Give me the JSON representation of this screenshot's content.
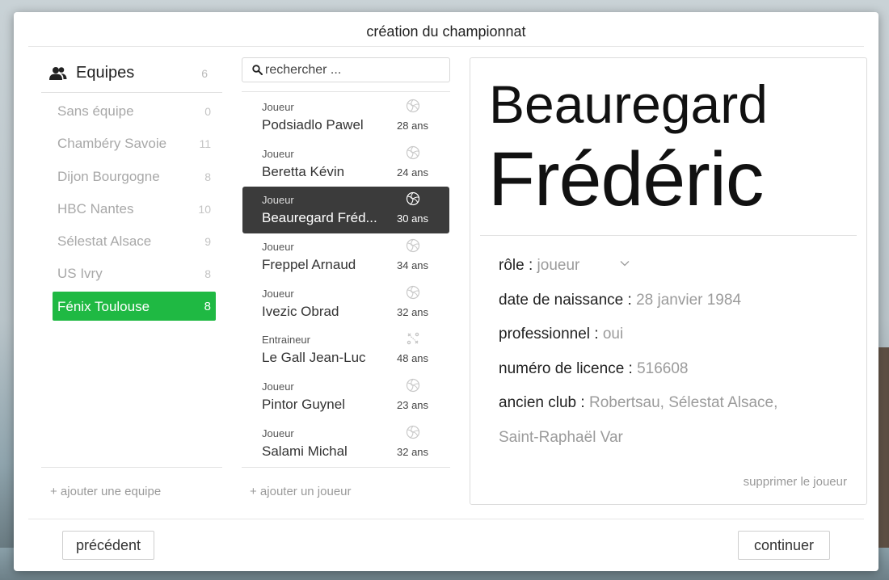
{
  "window": {
    "title": "création du championnat"
  },
  "teams": {
    "header_label": "Equipes",
    "header_count": "6",
    "items": [
      {
        "name": "Sans équipe",
        "count": "0"
      },
      {
        "name": "Chambéry Savoie",
        "count": "11"
      },
      {
        "name": "Dijon Bourgogne",
        "count": "8"
      },
      {
        "name": "HBC Nantes",
        "count": "10"
      },
      {
        "name": "Sélestat Alsace",
        "count": "9"
      },
      {
        "name": "US Ivry",
        "count": "8"
      },
      {
        "name": "Fénix Toulouse",
        "count": "8",
        "selected": true
      }
    ],
    "add_label": "+ ajouter une equipe"
  },
  "search": {
    "placeholder": "rechercher ..."
  },
  "players": {
    "items": [
      {
        "role": "Joueur",
        "name": "Podsiadlo Pawel",
        "age": "28 ans",
        "icon": "ball-icon"
      },
      {
        "role": "Joueur",
        "name": "Beretta Kévin",
        "age": "24 ans",
        "icon": "ball-icon"
      },
      {
        "role": "Joueur",
        "name": "Beauregard Fréd...",
        "age": "30 ans",
        "icon": "ball-icon",
        "selected": true
      },
      {
        "role": "Joueur",
        "name": "Freppel Arnaud",
        "age": "34 ans",
        "icon": "ball-icon"
      },
      {
        "role": "Joueur",
        "name": "Ivezic Obrad",
        "age": "32 ans",
        "icon": "ball-icon"
      },
      {
        "role": "Entraineur",
        "name": "Le Gall Jean-Luc",
        "age": "48 ans",
        "icon": "tactics-icon"
      },
      {
        "role": "Joueur",
        "name": "Pintor Guynel",
        "age": "23 ans",
        "icon": "ball-icon"
      },
      {
        "role": "Joueur",
        "name": "Salami Michal",
        "age": "32 ans",
        "icon": "ball-icon"
      }
    ],
    "add_label": "+ ajouter un joueur"
  },
  "detail": {
    "last_name": "Beauregard",
    "first_name": "Frédéric",
    "role_label": "rôle : ",
    "role_value": "joueur",
    "birth_label": "date de naissance : ",
    "birth_value": "28 janvier 1984",
    "pro_label": "professionnel : ",
    "pro_value": "oui",
    "license_label": "numéro de licence : ",
    "license_value": "516608",
    "club_label": "ancien club : ",
    "club_value_line1": "Robertsau, Sélestat Alsace,",
    "club_value_line2": "Saint-Raphaël Var",
    "delete_label": "supprimer le joueur"
  },
  "footer": {
    "prev_label": "précédent",
    "next_label": "continuer"
  },
  "colors": {
    "selected_team": "#1fb943",
    "selected_player": "#3b3b3b"
  }
}
